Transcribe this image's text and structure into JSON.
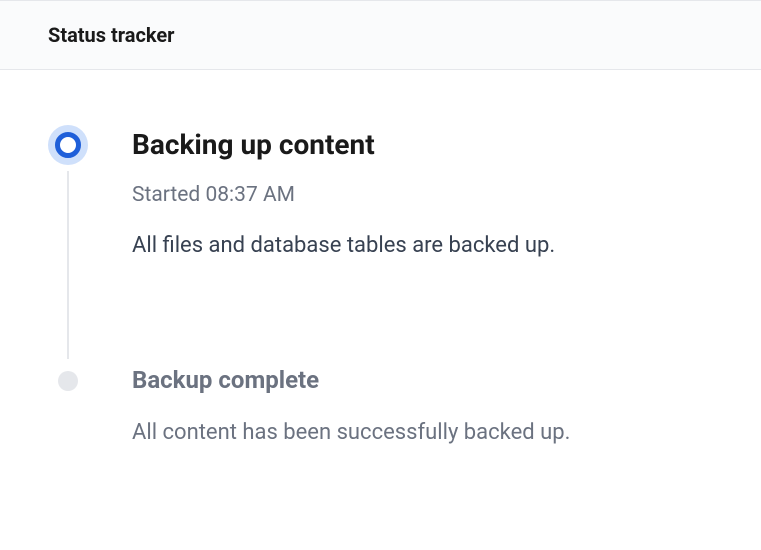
{
  "header": {
    "title": "Status tracker"
  },
  "steps": [
    {
      "title": "Backing up content",
      "subtitle": "Started 08:37 AM",
      "description": "All files and database tables are backed up.",
      "status": "active"
    },
    {
      "title": "Backup complete",
      "description": "All content has been successfully backed up.",
      "status": "pending"
    }
  ]
}
